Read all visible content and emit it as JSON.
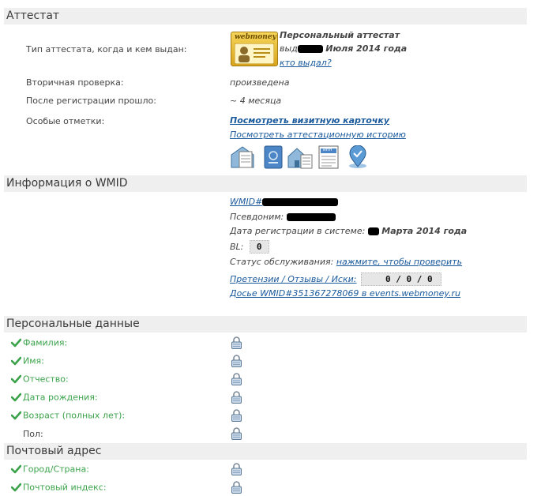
{
  "attestat": {
    "header": "Аттестат",
    "type_label": "Тип аттестата, когда и кем выдан:",
    "logo_text": "webmoney",
    "type_value": "Персональный аттестат",
    "issued_prefix": "выд",
    "issued_date": "Июля 2014 года",
    "who_issued_link": "кто выдал?",
    "secondary_label": "Вторичная проверка:",
    "secondary_value": "произведена",
    "since_reg_label": "После регистрации прошло:",
    "since_reg_value": "~ 4 месяца",
    "special_label": "Особые отметки:",
    "card_link": "Посмотреть визитную карточку",
    "history_link": "Посмотреть аттестационную историю",
    "inn_label": "ИНН"
  },
  "wmid_info": {
    "header": "Информация о WMID",
    "wmid_prefix": "WMID#",
    "nickname_label": "Псевдоним:",
    "reg_date_label": "Дата регистрации в системе:",
    "reg_date_value": "Марта 2014 года",
    "bl_label": "BL:",
    "bl_value": "0",
    "service_status_label": "Статус обслуживания:",
    "service_status_link": "нажмите, чтобы проверить",
    "claims_link": "Претензии / Отзывы / Иски:",
    "claims_value": "0 / 0 / 0",
    "dossier_link": "Досье WMID#351367278069 в events.webmoney.ru"
  },
  "personal": {
    "header": "Персональные данные",
    "fields": [
      {
        "label": "Фамилия:",
        "verified": true
      },
      {
        "label": "Имя:",
        "verified": true
      },
      {
        "label": "Отчество:",
        "verified": true
      },
      {
        "label": "Дата рождения:",
        "verified": true
      },
      {
        "label": "Возраст (полных лет):",
        "verified": true
      },
      {
        "label": "Пол:",
        "verified": false
      }
    ]
  },
  "postal": {
    "header": "Почтовый адрес",
    "fields": [
      {
        "label": "Город/Страна:",
        "verified": true
      },
      {
        "label": "Почтовый индекс:",
        "verified": true
      }
    ]
  },
  "colors": {
    "link": "#1a5a9c",
    "green": "#3aa24a",
    "header_bg": "#efefef"
  }
}
